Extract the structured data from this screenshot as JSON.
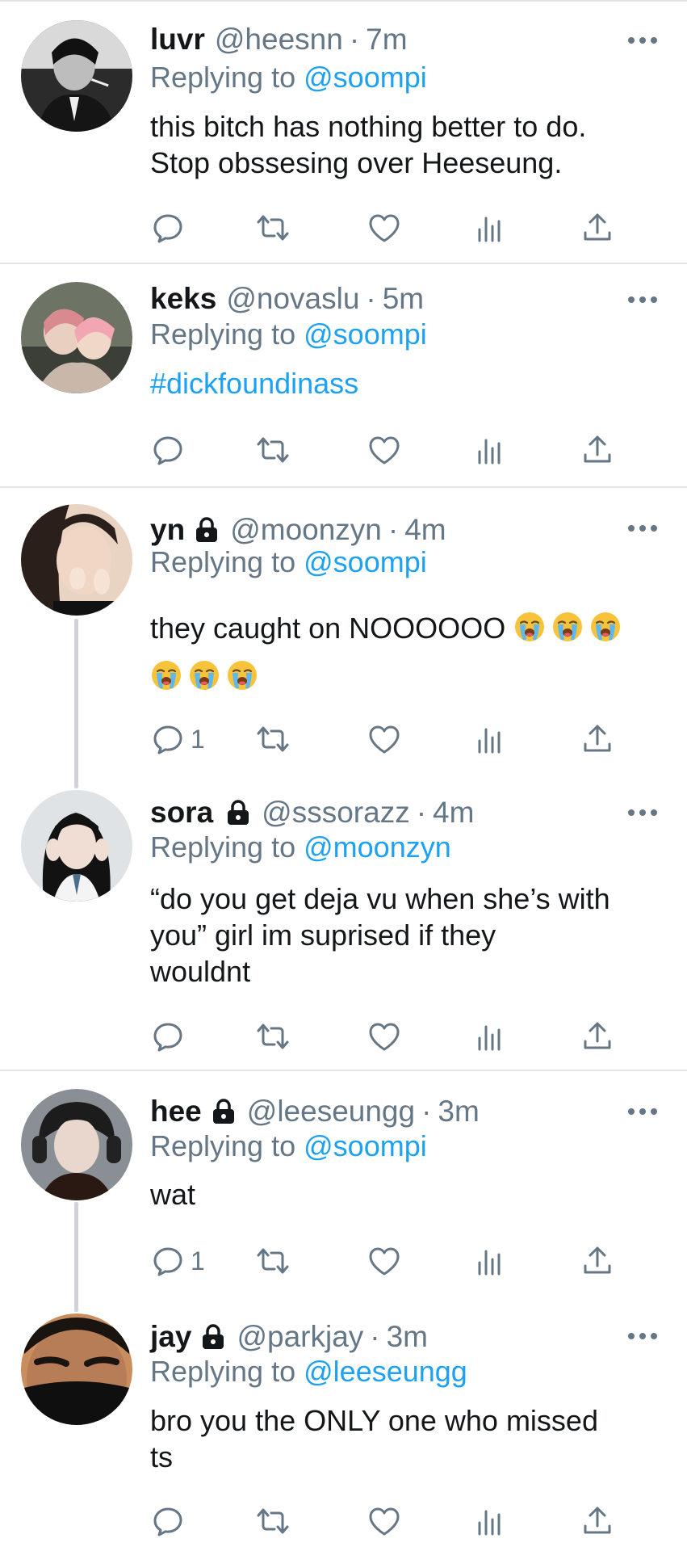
{
  "tweets": [
    {
      "name": "luvr",
      "locked": false,
      "handle": "@heesnn",
      "time": "7m",
      "replying_label": "Replying to",
      "replying_to": "@soompi",
      "text_lines": [
        "this bitch has nothing better to do.",
        "Stop obssesing over Heeseung."
      ],
      "is_hashtag": false,
      "reply_count": "",
      "avatar": "dark monochrome portrait"
    },
    {
      "name": "keks",
      "locked": false,
      "handle": "@novaslu",
      "time": "5m",
      "replying_label": "Replying to",
      "replying_to": "@soompi",
      "text_lines": [
        "#dickfoundinass"
      ],
      "is_hashtag": true,
      "reply_count": "",
      "avatar": "two people hugging, pink hair"
    },
    {
      "name": "yn",
      "locked": true,
      "handle": "@moonzyn",
      "time": "4m",
      "replying_label": "Replying to",
      "replying_to": "@soompi",
      "text_lines": [
        "they caught on NOOOOOO"
      ],
      "emoji_line1_count": 3,
      "emoji_line2_count": 3,
      "emoji_name": "loudly-crying-face",
      "is_hashtag": false,
      "reply_count": "1",
      "avatar": "girl with hands on face"
    },
    {
      "name": "sora",
      "locked": true,
      "handle": "@sssorazz",
      "time": "4m",
      "replying_label": "Replying to",
      "replying_to": "@moonzyn",
      "text_lines": [
        "“do you get deja vu when she’s with",
        "you” girl im suprised if they",
        "wouldnt"
      ],
      "is_hashtag": false,
      "reply_count": "",
      "avatar": "girl with black hair, school uniform"
    },
    {
      "name": "hee",
      "locked": true,
      "handle": "@leeseungg",
      "time": "3m",
      "replying_label": "Replying to",
      "replying_to": "@soompi",
      "text_lines": [
        "wat"
      ],
      "is_hashtag": false,
      "reply_count": "1",
      "avatar": "boy with dark hair, headphones"
    },
    {
      "name": "jay",
      "locked": true,
      "handle": "@parkjay",
      "time": "3m",
      "replying_label": "Replying to",
      "replying_to": "@leeseungg",
      "text_lines": [
        "bro you the ONLY one who missed",
        "ts"
      ],
      "is_hashtag": false,
      "reply_count": "",
      "avatar": "close-up face with mask"
    }
  ],
  "icons": {
    "reply": "reply-icon",
    "retweet": "retweet-icon",
    "like": "like-icon",
    "analytics": "analytics-icon",
    "share": "share-icon",
    "more": "more-options-icon",
    "lock": "lock-icon"
  },
  "colors": {
    "text": "#14171a",
    "secondary": "#657786",
    "link": "#1da1f2",
    "divider": "#e3e5e8"
  }
}
